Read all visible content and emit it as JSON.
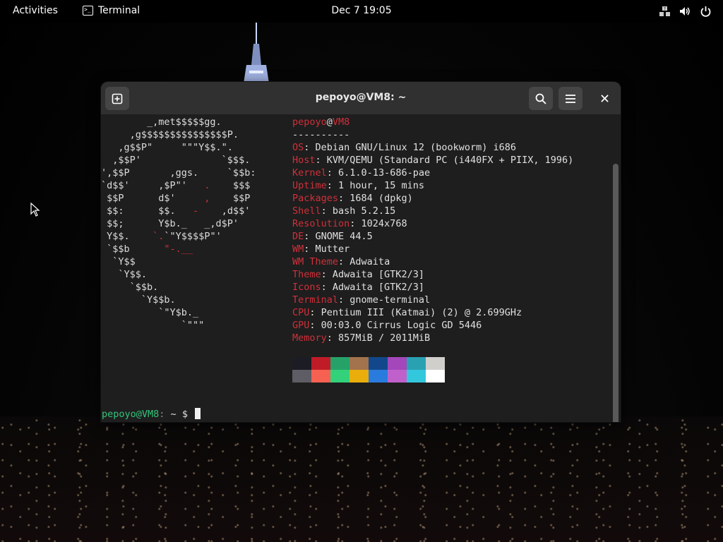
{
  "topbar": {
    "activities_label": "Activities",
    "app_label": "Terminal",
    "clock": "Dec 7  19:05",
    "tray_icons": [
      "network-icon",
      "volume-icon",
      "power-icon"
    ]
  },
  "window": {
    "title": "pepoyo@VM8: ~",
    "buttons": [
      "new-tab-icon",
      "search-icon",
      "hamburger-menu-icon",
      "close-icon"
    ]
  },
  "neofetch": {
    "user": "pepoyo",
    "at": "@",
    "host": "VM8",
    "separator": "----------",
    "lines": [
      {
        "key": "OS",
        "value": "Debian GNU/Linux 12 (bookworm) i686"
      },
      {
        "key": "Host",
        "value": "KVM/QEMU (Standard PC (i440FX + PIIX, 1996)"
      },
      {
        "key": "Kernel",
        "value": "6.1.0-13-686-pae"
      },
      {
        "key": "Uptime",
        "value": "1 hour, 15 mins"
      },
      {
        "key": "Packages",
        "value": "1684 (dpkg)"
      },
      {
        "key": "Shell",
        "value": "bash 5.2.15"
      },
      {
        "key": "Resolution",
        "value": "1024x768"
      },
      {
        "key": "DE",
        "value": "GNOME 44.5"
      },
      {
        "key": "WM",
        "value": "Mutter"
      },
      {
        "key": "WM Theme",
        "value": "Adwaita"
      },
      {
        "key": "Theme",
        "value": "Adwaita [GTK2/3]"
      },
      {
        "key": "Icons",
        "value": "Adwaita [GTK2/3]"
      },
      {
        "key": "Terminal",
        "value": "gnome-terminal"
      },
      {
        "key": "CPU",
        "value": "Pentium III (Katmai) (2) @ 2.699GHz"
      },
      {
        "key": "GPU",
        "value": "00:03.0 Cirrus Logic GD 5446"
      },
      {
        "key": "Memory",
        "value": "857MiB / 2011MiB"
      }
    ],
    "palette": [
      "#1c1c24",
      "#c01c28",
      "#26a269",
      "#a2734c",
      "#12488b",
      "#a347ba",
      "#2aa1b3",
      "#d0cfcc",
      "#5e5c64",
      "#f66151",
      "#33d17a",
      "#e9ad0c",
      "#2a7bde",
      "#c061cb",
      "#33c7de",
      "#ffffff"
    ]
  },
  "prompt": {
    "user_host": "pepoyo@VM8",
    "separator": ":",
    "path": " ~",
    "symbol": "$ "
  }
}
